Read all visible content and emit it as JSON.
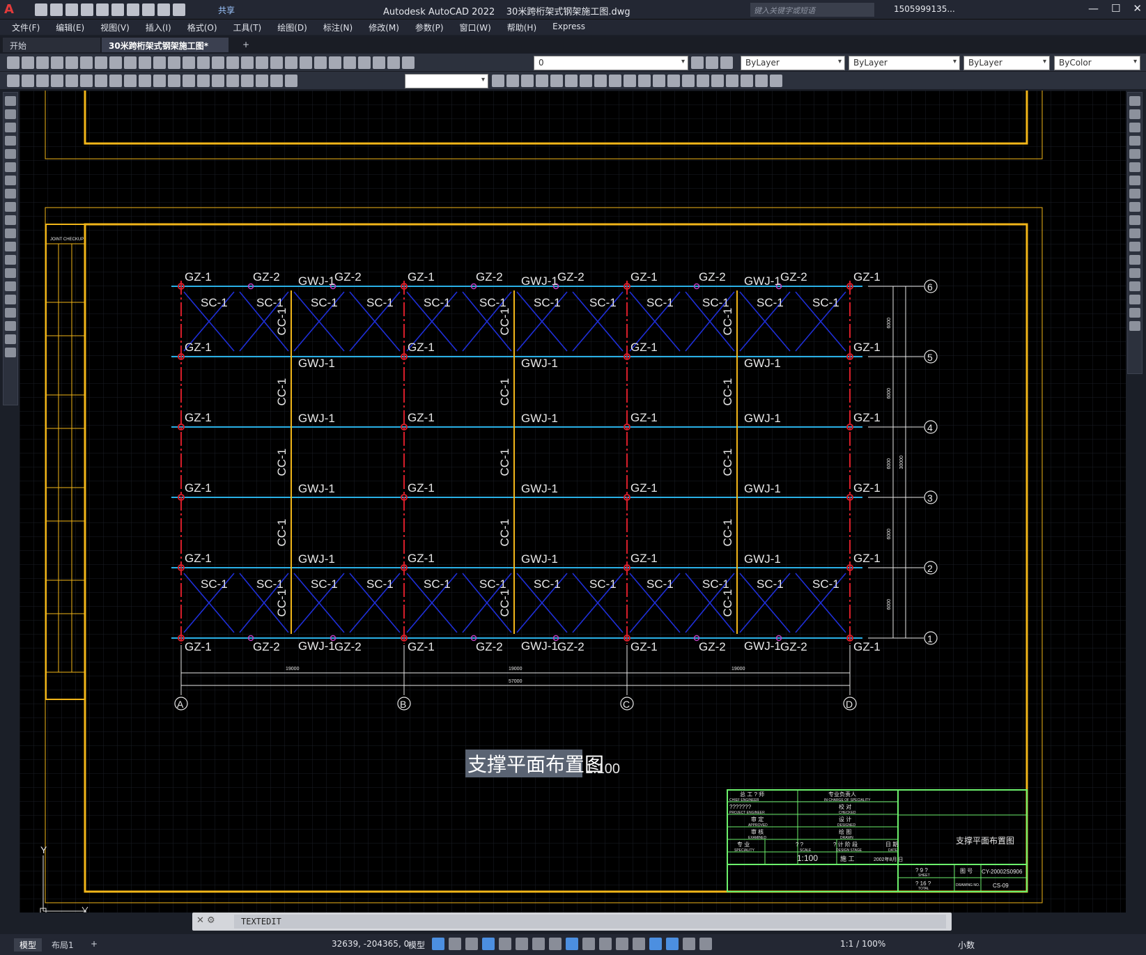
{
  "app": {
    "logo": "A",
    "title": "Autodesk AutoCAD 2022",
    "filename": "30米跨桁架式钢架施工图.dwg",
    "share": "共享",
    "search_placeholder": "键入关键字或短语",
    "user": "1505999135...",
    "window_buttons": [
      "—",
      "☐",
      "✕"
    ]
  },
  "menu": [
    "文件(F)",
    "编辑(E)",
    "视图(V)",
    "插入(I)",
    "格式(O)",
    "工具(T)",
    "绘图(D)",
    "标注(N)",
    "修改(M)",
    "参数(P)",
    "窗口(W)",
    "帮助(H)",
    "Express"
  ],
  "tabs": {
    "start": "开始",
    "active": "30米跨桁架式钢架施工图*",
    "add": "+"
  },
  "properties": {
    "layer": "0",
    "color": "ByLayer",
    "linetype": "ByLayer",
    "lineweight": "ByLayer",
    "plotstyle": "ByColor"
  },
  "drawing": {
    "axes_letters": [
      "A",
      "B",
      "C",
      "D"
    ],
    "axes_numbers": [
      "1",
      "2",
      "3",
      "4",
      "5",
      "6"
    ],
    "gz1": "GZ-1",
    "gz2": "GZ-2",
    "gwj1": "GWJ-1",
    "sc1": "SC-1",
    "cc1": "CC-1",
    "dim_bay": "19000",
    "dim_total": "57000",
    "dim_span": "6000",
    "dim_length": "30000",
    "plan_title": "支撑平面布置图",
    "plan_scale": "1:100",
    "joint_checkup": "JOINT CHECKUP",
    "ucs_y": "Y",
    "ucs_x": "X"
  },
  "titleblock": {
    "chief_engineer": "总 工 ? 师",
    "chief_engineer_en": "CHIEF ENGINEER",
    "project_engineer": "???????",
    "project_engineer_en": "PROJECT ENGINEER",
    "approved": "审 定",
    "approved_en": "APPROVED",
    "examined": "审 核",
    "examined_en": "EXAMINED",
    "speciality": "专 业",
    "speciality_en": "SPECIALITY",
    "in_charge": "专业负责人",
    "in_charge_en": "IN CHARGE OF SPECIALITY",
    "checked": "校 对",
    "checked_en": "CHECKED",
    "designed": "设 计",
    "designed_en": "DESIGNED",
    "drawn": "绘 图",
    "drawn_en": "DRAWN",
    "scale_label": "? ?",
    "scale_en": "SCALE",
    "stage_label": "? 计 阶 段",
    "stage_en": "DESIGN STAGE",
    "date_label": "日 期",
    "date_en": "DATE",
    "scale_value": "1:100",
    "stage_value": "施 工",
    "date_value": "2002年8月 日",
    "sheet_name": "支撑平面布置图",
    "sheet": "? 9 ?",
    "sheet_en": "SHEET",
    "total": "? 16 ?",
    "total_en": "TOTAL",
    "drawing_no_label": "图 号",
    "drawing_no_en": "DRAWING NO.",
    "project_no": "CY-20002S0906",
    "drawing_no": "CS-09"
  },
  "command": {
    "text": "TEXTEDIT"
  },
  "status": {
    "model_tab": "模型",
    "layout_tab": "布局1",
    "add_tab": "+",
    "coords": "32639, -204365, 0",
    "mode": "模型",
    "scale": "1:1 / 100%",
    "units": "小数"
  },
  "colors": {
    "frame": "#f2b619",
    "beam": "#2ab0e6",
    "brace": "#1f2fd8",
    "column": "#d81e2a",
    "titleblock": "#6cf06c",
    "text": "#e8e8e8"
  }
}
